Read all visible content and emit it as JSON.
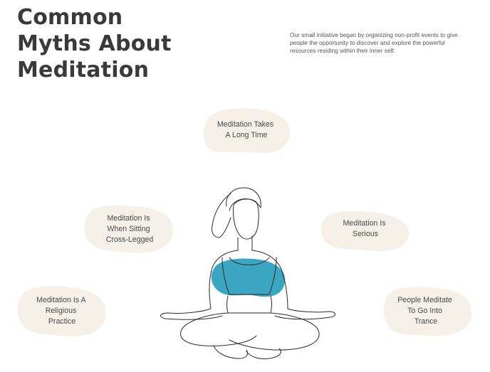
{
  "header": {
    "title": "Common\nMyths About\nMeditation",
    "intro": "Our small initiative began by organizing non-profit events to give people the opportunity to discover and explore the powerful resources residing within their inner self."
  },
  "myths": [
    {
      "lines": [
        "Meditation Takes",
        "A Long Time"
      ]
    },
    {
      "lines": [
        "Meditation Is",
        "When Sitting",
        "Cross-Legged"
      ]
    },
    {
      "lines": [
        "Meditation Is",
        "Serious"
      ]
    },
    {
      "lines": [
        "Meditation Is A",
        "Religious",
        "Practice"
      ]
    },
    {
      "lines": [
        "People Meditate",
        "To Go Into",
        "Trance"
      ]
    }
  ],
  "colors": {
    "accent": "#3aa6c2",
    "blob": "#f6f0e8",
    "text": "#3a3a3a"
  },
  "icons": {
    "figure": "meditating-woman-illustration"
  }
}
